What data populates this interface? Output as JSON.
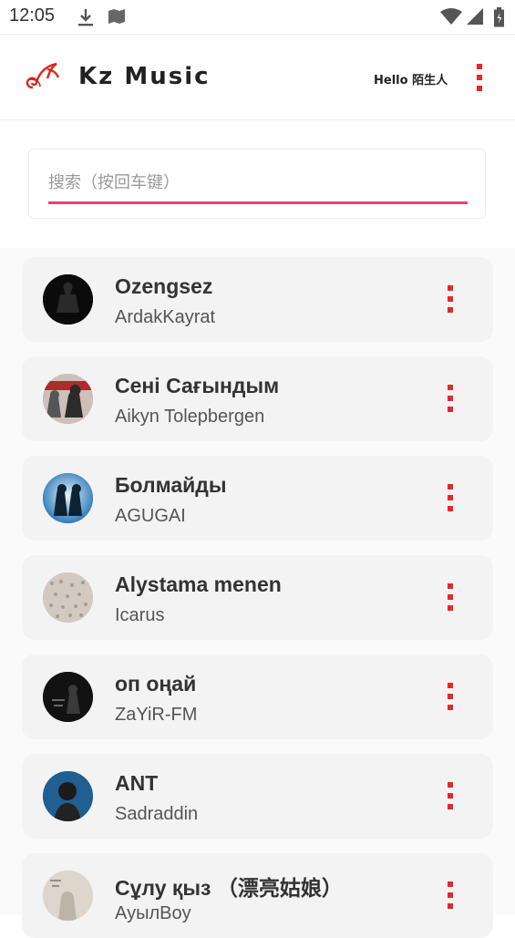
{
  "status_bar": {
    "time": "12:05"
  },
  "header": {
    "app_title": "Kz Music",
    "greeting": "Hello 陌生人"
  },
  "search": {
    "placeholder": "搜索（按回车键）",
    "value": ""
  },
  "songs": [
    {
      "title": "Ozengsez",
      "artist": "ArdakKayrat",
      "cover_color": "#0b0b0b"
    },
    {
      "title": "Сені Сағындым",
      "artist": "Aikyn Tolepbergen",
      "cover_color": "#b9a9a4"
    },
    {
      "title": "Болмайды",
      "artist": "AGUGAI",
      "cover_color": "#2f7bb8"
    },
    {
      "title": "Alystama menen",
      "artist": "Icarus",
      "cover_color": "#cfc6bd"
    },
    {
      "title": "оп оңай",
      "artist": "ZaYiR-FM",
      "cover_color": "#141414"
    },
    {
      "title": "ANT",
      "artist": "Sadraddin",
      "cover_color": "#1f5f91"
    },
    {
      "title": "Сұлу қыз （漂亮姑娘）",
      "artist": "АуылBoy",
      "cover_color": "#d9d3c9"
    }
  ],
  "colors": {
    "accent": "#e82727",
    "search_underline": "#ee3d78"
  }
}
